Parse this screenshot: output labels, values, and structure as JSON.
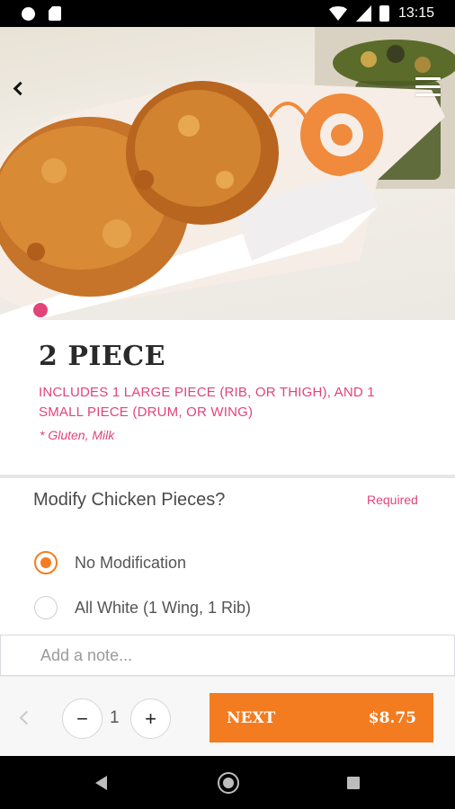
{
  "status_bar": {
    "time": "13:15",
    "icons": [
      "notification-dot-icon",
      "sd-card-icon",
      "wifi-icon",
      "signal-icon",
      "battery-icon"
    ]
  },
  "header": {
    "back_icon": "chevron-left-icon",
    "menu_icon": "hamburger-menu-icon",
    "hero_image": "fried-chicken-photo"
  },
  "product": {
    "title": "2 PIECE",
    "description": "INCLUDES 1 LARGE PIECE (RIB, OR THIGH), AND 1 SMALL PIECE (DRUM, OR WING)",
    "allergens": "* Gluten, Milk"
  },
  "modifier": {
    "title": "Modify Chicken Pieces?",
    "required_label": "Required",
    "options": [
      {
        "label": "No Modification",
        "selected": true
      },
      {
        "label": "All White (1 Wing, 1 Rib)",
        "selected": false
      }
    ]
  },
  "note": {
    "placeholder": "Add a note..."
  },
  "footer": {
    "quantity": "1",
    "minus_label": "−",
    "plus_label": "+",
    "next_label": "NEXT",
    "price": "$8.75"
  },
  "colors": {
    "accent_orange": "#f47c20",
    "accent_pink": "#e1447a",
    "title_text": "#2a2a2a"
  }
}
